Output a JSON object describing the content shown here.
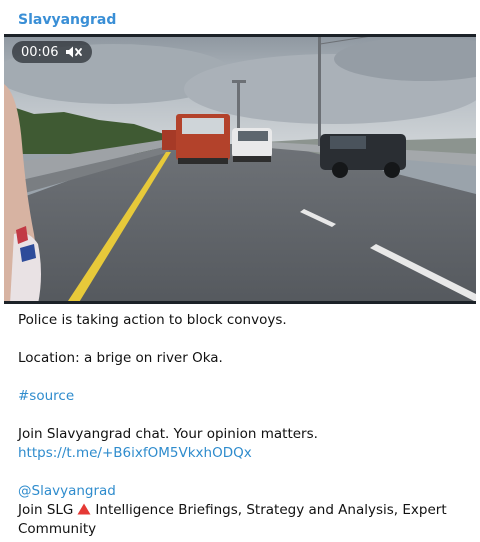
{
  "post": {
    "author": "Slavyangrad",
    "video": {
      "duration": "00:06",
      "muted_icon": "volume-mute-icon"
    },
    "lines": {
      "line1": "Police is taking action to block convoys.",
      "line2": "Location: a brige on river Oka.",
      "hashtag": "#source",
      "join_chat": "Join Slavyangrad chat. Your opinion matters.",
      "invite_link": "https://t.me/+B6ixfOM5VkxhODQx",
      "mention": "@Slavyangrad",
      "join_slg_prefix": "Join SLG",
      "join_slg_icon": "red-triangle-icon",
      "join_slg_rest": "Intelligence Briefings, Strategy and Analysis, Expert",
      "join_slg_cont": "Community"
    },
    "colors": {
      "link": "#2f8ccd",
      "author": "#3a8fd6",
      "triangle": "#e53935"
    }
  }
}
